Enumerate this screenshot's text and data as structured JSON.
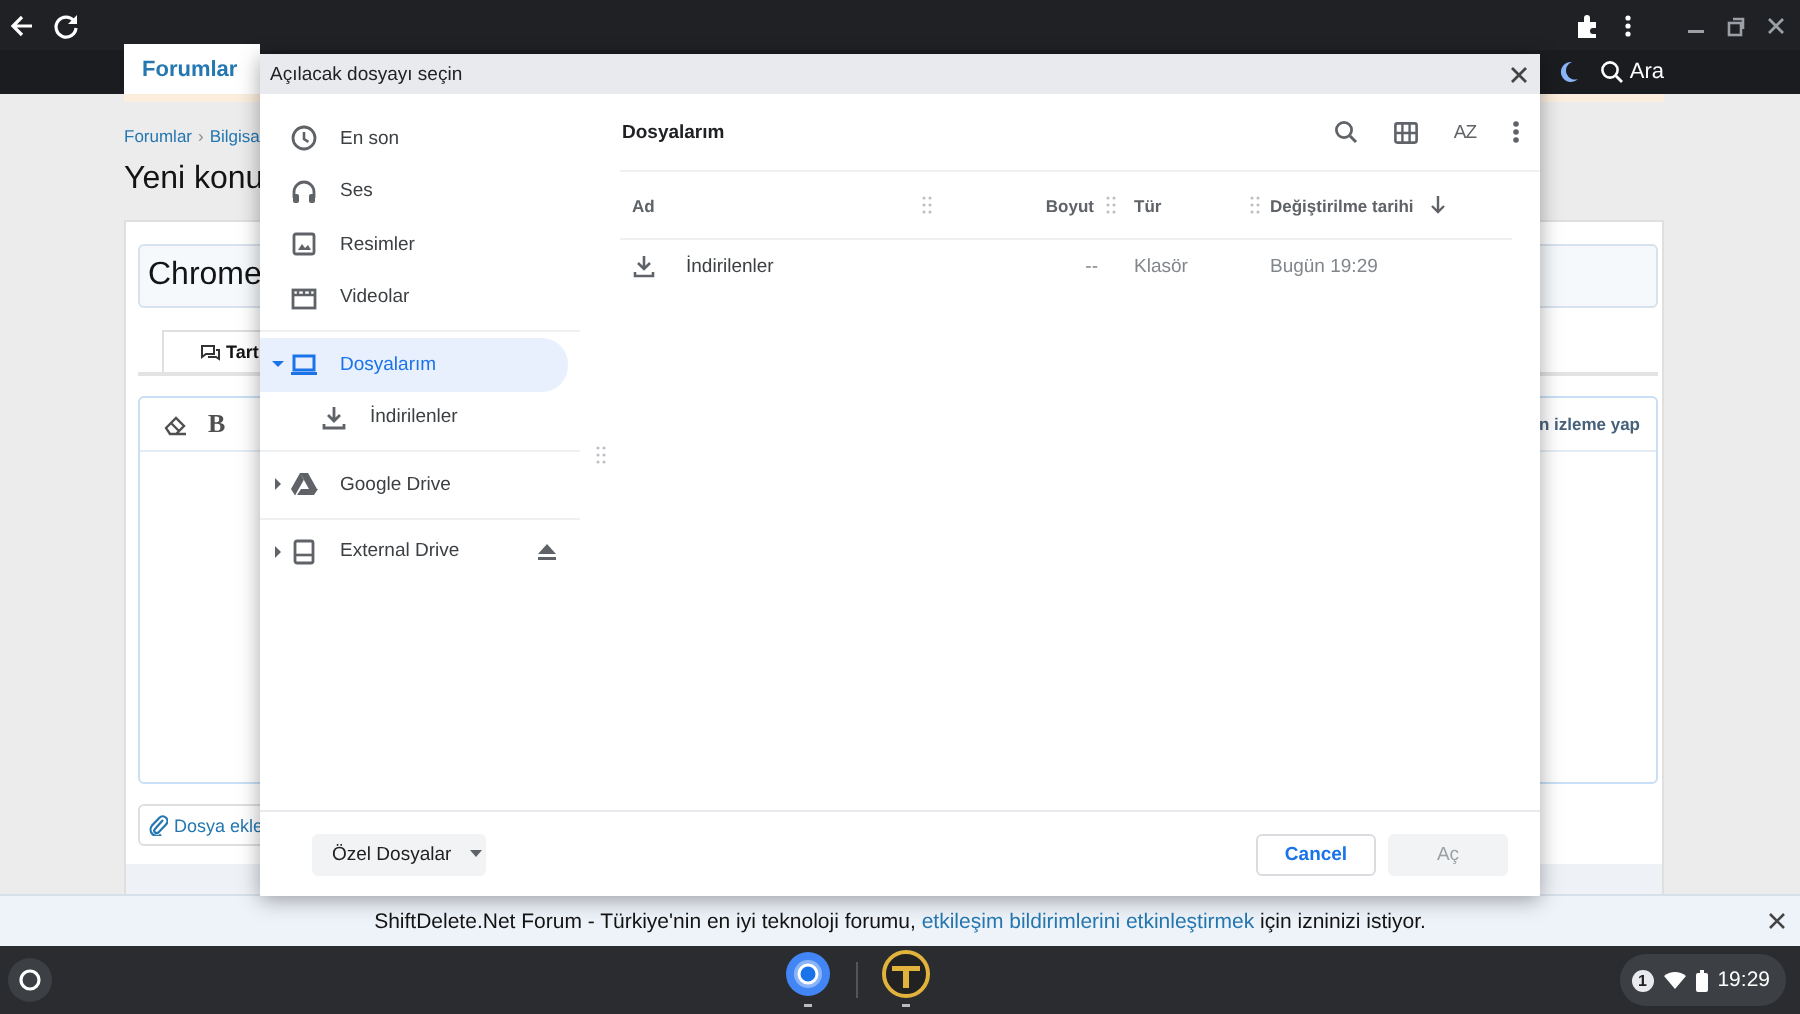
{
  "site_nav": {
    "tab": "Forumlar",
    "search": "Ara"
  },
  "page": {
    "breadcrumb": [
      "Forumlar",
      "Bilgisa"
    ],
    "breadcrumb_separator": "›",
    "heading": "Yeni konu",
    "title_field": {
      "value": "Chrome"
    },
    "editor_tab": "Tart",
    "bold_button": "B",
    "editor_toolbar_text": "n izleme yap",
    "attach_button": "Dosya ekle"
  },
  "dialog": {
    "title": "Açılacak dosyayı seçin",
    "sidebar": {
      "sections": [
        {
          "items": [
            {
              "label": "En son",
              "selected": false
            },
            {
              "label": "Ses",
              "selected": false
            },
            {
              "label": "Resimler",
              "selected": false
            },
            {
              "label": "Videolar",
              "selected": false
            }
          ]
        },
        {
          "items": [
            {
              "label": "Dosyalarım",
              "selected": true,
              "expanded": true,
              "children": [
                {
                  "label": "İndirilenler",
                  "selected": false
                }
              ]
            }
          ]
        },
        {
          "items": [
            {
              "label": "Google Drive",
              "selected": false,
              "expanded": false
            }
          ]
        },
        {
          "items": [
            {
              "label": "External Drive",
              "selected": false,
              "expanded": false
            }
          ]
        }
      ]
    },
    "folder_title": "Dosyalarım",
    "sort_button": "AZ",
    "table": {
      "columns": [
        "Ad",
        "Boyut",
        "Tür",
        "Değiştirilme tarihi"
      ],
      "rows": [
        {
          "name": "İndirilenler",
          "size": "--",
          "type": "Klasör",
          "modified": "Bugün 19:29",
          "selected": false
        }
      ]
    },
    "file_type_filter": "Özel Dosyalar",
    "buttons": [
      {
        "label": "Cancel",
        "disabled": false
      },
      {
        "label": "Aç",
        "disabled": true
      }
    ]
  },
  "notification": {
    "text_before": "ShiftDelete.Net Forum - Türkiye'nin en iyi teknoloji forumu, ",
    "link": "etkileşim bildirimlerini etkinleştirmek",
    "text_after": " için izninizi istiyor."
  },
  "shelf": {
    "notification_count": "1",
    "time": "19:29"
  }
}
